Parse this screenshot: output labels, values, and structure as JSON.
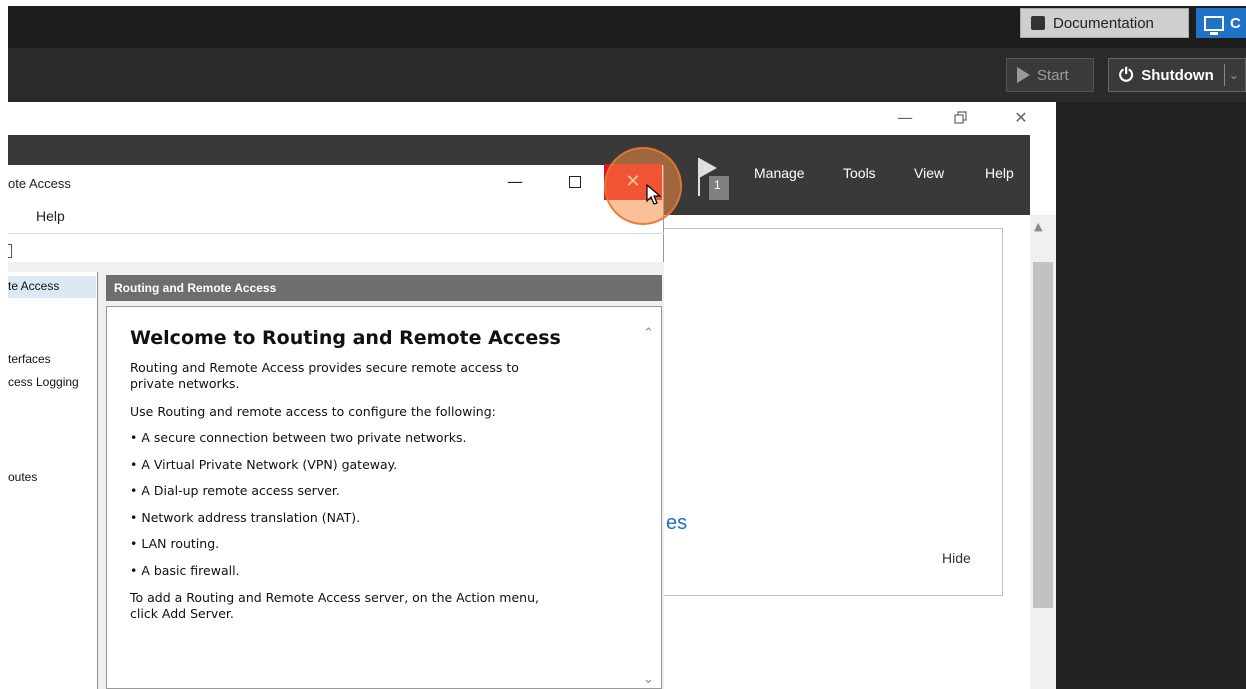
{
  "host": {
    "documentation_label": "Documentation",
    "blue_button_label": "C",
    "start_label": "Start",
    "shutdown_label": "Shutdown"
  },
  "server_manager": {
    "menu": [
      "Manage",
      "Tools",
      "View",
      "Help"
    ],
    "notification_count": "1",
    "partial_link_text": "es",
    "hide_label": "Hide"
  },
  "rras_window": {
    "title_partial": "ote Access",
    "menu_help": "Help",
    "tree_items": [
      "te Access",
      "terfaces",
      "cess Logging",
      "outes"
    ],
    "pane_header": "Routing and Remote Access",
    "heading": "Welcome to Routing and Remote Access",
    "intro_line1": "Routing and Remote Access provides secure remote access to",
    "intro_line2": "private networks.",
    "use_line": "Use Routing and remote access to configure the following:",
    "bullets": [
      "• A secure connection between two private networks.",
      "• A Virtual Private Network (VPN) gateway.",
      "• A Dial-up remote access server.",
      "• Network address translation (NAT).",
      "• LAN routing.",
      "• A basic firewall."
    ],
    "footer_line1": "To add a Routing and Remote Access server, on the Action menu,",
    "footer_line2": "click Add Server."
  },
  "colors": {
    "close_red": "#e81123",
    "link_blue": "#1a73c9",
    "host_blue": "#1e73c9"
  }
}
